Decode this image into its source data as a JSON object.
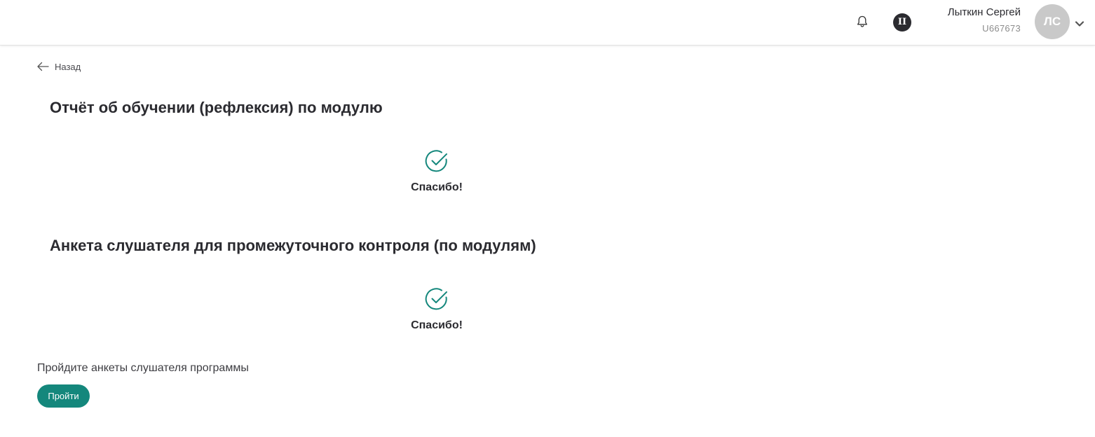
{
  "header": {
    "notifications_icon": "bell-icon",
    "badge_label": "II",
    "user": {
      "name": "Лыткин Сергей",
      "id": "U667673",
      "initials": "ЛС"
    },
    "menu_icon": "chevron-down-icon"
  },
  "nav": {
    "back_label": "Назад",
    "back_icon": "arrow-left-icon"
  },
  "sections": [
    {
      "title": "Отчёт об обучении (рефлексия) по модулю",
      "status_icon": "check-circle-icon",
      "status_text": "Спасибо!"
    },
    {
      "title": "Анкета слушателя для промежуточного контроля (по модулям)",
      "status_icon": "check-circle-icon",
      "status_text": "Спасибо!"
    }
  ],
  "footer": {
    "prompt": "Пройдите анкеты слушателя программы",
    "button_label": "Пройти"
  },
  "colors": {
    "accent": "#14877c",
    "text": "#2b2b30",
    "muted": "#8c8c8c",
    "avatar_bg": "#c9c9c9"
  }
}
